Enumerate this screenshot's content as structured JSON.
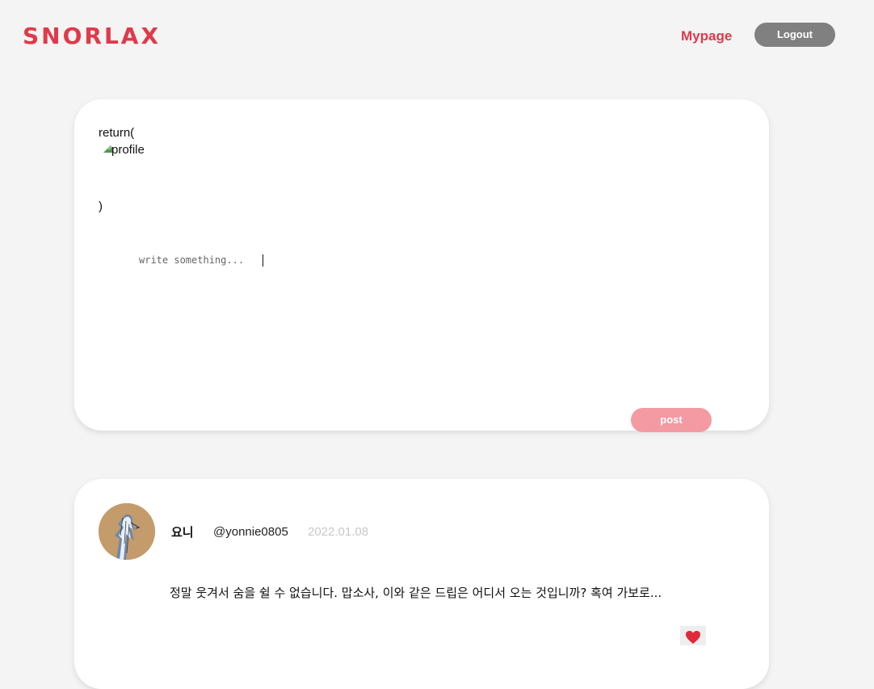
{
  "header": {
    "logo": "SNORLAX",
    "mypage_label": "Mypage",
    "logout_label": "Logout"
  },
  "composer": {
    "code_open": "return(",
    "image_alt": "profile",
    "code_close": ")",
    "placeholder": "write something...",
    "post_label": "post"
  },
  "feed": {
    "posts": [
      {
        "user_name": "요니",
        "handle": "@yonnie0805",
        "date": "2022.01.08",
        "content": "정말 웃겨서 숨을 쉴 수 없습니다. 맙소사, 이와 같은 드립은 어디서 오는 것입니까? 혹여 가보로...",
        "like_icon": "heart-icon"
      }
    ]
  },
  "colors": {
    "brand": "#e03a4a",
    "logout_bg": "#808080",
    "post_btn_bg": "#f39aa3",
    "background": "#f4f4f4",
    "card": "#ffffff"
  }
}
